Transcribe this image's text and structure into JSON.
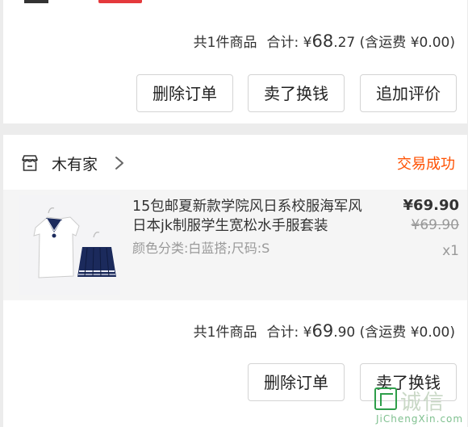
{
  "top_order": {
    "summary": {
      "count_text": "共1件商品",
      "total_label": "合计:",
      "currency": "¥",
      "amount_main": "68",
      "amount_decimal": ".27",
      "shipping_text": "(含运费 ¥0.00)"
    },
    "buttons": {
      "delete": "删除订单",
      "sell": "卖了换钱",
      "review": "追加评价"
    }
  },
  "order": {
    "shop_name": "木有家",
    "status": "交易成功",
    "product": {
      "title": "15包邮夏新款学院风日系校服海军风日本jk制服学生宽松水手服套装",
      "spec": "颜色分类:白蓝搭;尺码:S",
      "price": "¥69.90",
      "original_price": "¥69.90",
      "quantity": "x1"
    },
    "summary": {
      "count_text": "共1件商品",
      "total_label": "合计:",
      "currency": "¥",
      "amount_main": "69",
      "amount_decimal": ".90",
      "shipping_text": "(含运费 ¥0.00)"
    },
    "buttons": {
      "delete": "删除订单",
      "sell": "卖了换钱"
    }
  },
  "watermark": {
    "chars": "诚信",
    "url": "JiChengXin.com"
  },
  "colors": {
    "status": "#ff5000",
    "background": "#ececec",
    "card": "#ffffff"
  }
}
